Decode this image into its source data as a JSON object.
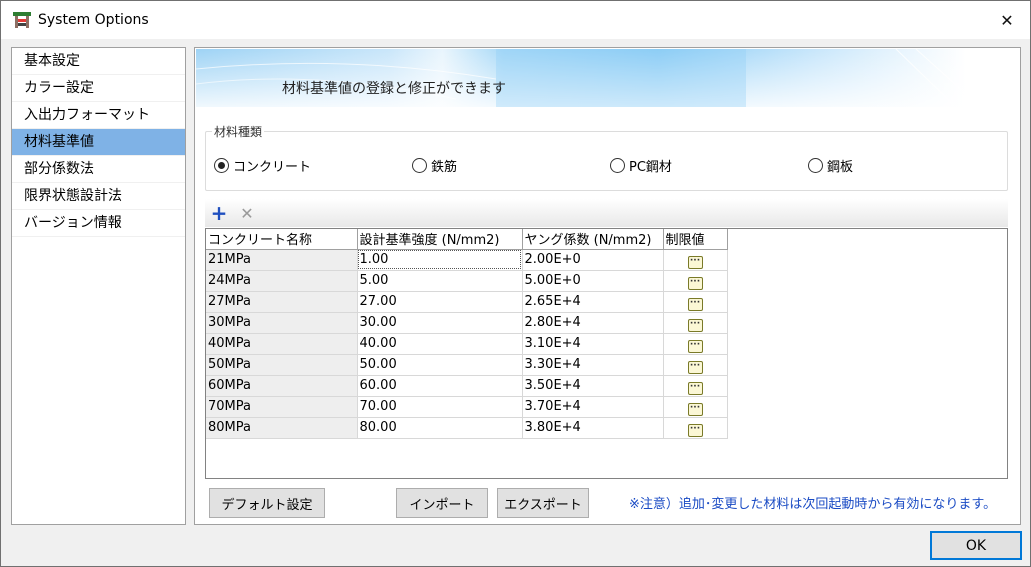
{
  "window": {
    "title": "System Options",
    "close_glyph": "✕"
  },
  "sidebar": {
    "items": [
      {
        "label": "基本設定"
      },
      {
        "label": "カラー設定"
      },
      {
        "label": "入出力フォーマット"
      },
      {
        "label": "材料基準値",
        "selected": true
      },
      {
        "label": "部分係数法"
      },
      {
        "label": "限界状態設計法"
      },
      {
        "label": "バージョン情報"
      }
    ]
  },
  "banner": {
    "text": "材料基準値の登録と修正ができます"
  },
  "material_type": {
    "legend": "材料種類",
    "options": [
      {
        "label": "コンクリート",
        "selected": true
      },
      {
        "label": "鉄筋",
        "selected": false
      },
      {
        "label": "PC鋼材",
        "selected": false
      },
      {
        "label": "鋼板",
        "selected": false
      }
    ]
  },
  "toolbar": {
    "add_glyph": "+",
    "delete_glyph": "✕"
  },
  "grid": {
    "headers": [
      "コンクリート名称",
      "設計基準強度 (N/mm2)",
      "ヤング係数 (N/mm2)",
      "制限値"
    ],
    "rows": [
      [
        "21MPa",
        "1.00",
        "2.00E+0"
      ],
      [
        "24MPa",
        "5.00",
        "5.00E+0"
      ],
      [
        "27MPa",
        "27.00",
        "2.65E+4"
      ],
      [
        "30MPa",
        "30.00",
        "2.80E+4"
      ],
      [
        "40MPa",
        "40.00",
        "3.10E+4"
      ],
      [
        "50MPa",
        "50.00",
        "3.30E+4"
      ],
      [
        "60MPa",
        "60.00",
        "3.50E+4"
      ],
      [
        "70MPa",
        "70.00",
        "3.70E+4"
      ],
      [
        "80MPa",
        "80.00",
        "3.80E+4"
      ]
    ],
    "ellipsis_glyph": "···"
  },
  "buttons": {
    "default_settings": "デフォルト設定",
    "import": "インポート",
    "export": "エクスポート",
    "ok": "OK"
  },
  "note": "※注意）追加･変更した材料は次回起動時から有効になります。",
  "colors": {
    "selection": "#7fb2e6",
    "accent_blue": "#0078d7",
    "note_blue": "#1a4bc4"
  }
}
